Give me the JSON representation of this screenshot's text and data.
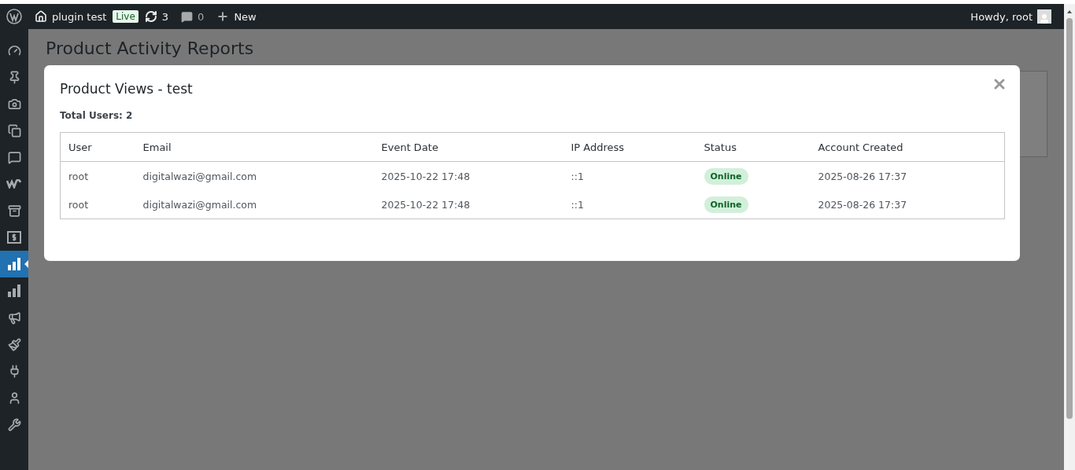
{
  "admin_bar": {
    "site_name": "plugin test",
    "site_badge": "Live",
    "updates": "3",
    "comments": "0",
    "new": "New",
    "greeting": "Howdy, root"
  },
  "sidebar": {
    "items": [
      {
        "kind": "dashboard",
        "selected": false
      },
      {
        "kind": "pin",
        "selected": false
      },
      {
        "kind": "media",
        "selected": false
      },
      {
        "kind": "pages",
        "selected": false
      },
      {
        "kind": "comments",
        "selected": false
      },
      {
        "kind": "woo",
        "selected": false
      },
      {
        "kind": "archive",
        "selected": false
      },
      {
        "kind": "money",
        "selected": false
      },
      {
        "kind": "chart",
        "selected": true
      },
      {
        "kind": "chart",
        "selected": false
      },
      {
        "kind": "megaphone",
        "selected": false
      },
      {
        "kind": "brush",
        "selected": false
      },
      {
        "kind": "plug",
        "selected": false
      },
      {
        "kind": "user",
        "selected": false
      },
      {
        "kind": "wrench",
        "selected": false
      }
    ]
  },
  "page": {
    "title": "Product Activity Reports"
  },
  "modal": {
    "title": "Product Views - test",
    "summary": "Total Users: 2",
    "table": {
      "columns": [
        "User",
        "Email",
        "Event Date",
        "IP Address",
        "Status",
        "Account Created"
      ],
      "rows": [
        {
          "user": "root",
          "email": "digitalwazi@gmail.com",
          "event_date": "2025-10-22 17:48",
          "ip": "::1",
          "status": {
            "label": "Online",
            "kind": "online"
          },
          "created": "2025-08-26 17:37"
        },
        {
          "user": "root",
          "email": "digitalwazi@gmail.com",
          "event_date": "2025-10-22 17:48",
          "ip": "::1",
          "status": {
            "label": "Online",
            "kind": "online"
          },
          "created": "2025-08-26 17:37"
        }
      ]
    }
  }
}
